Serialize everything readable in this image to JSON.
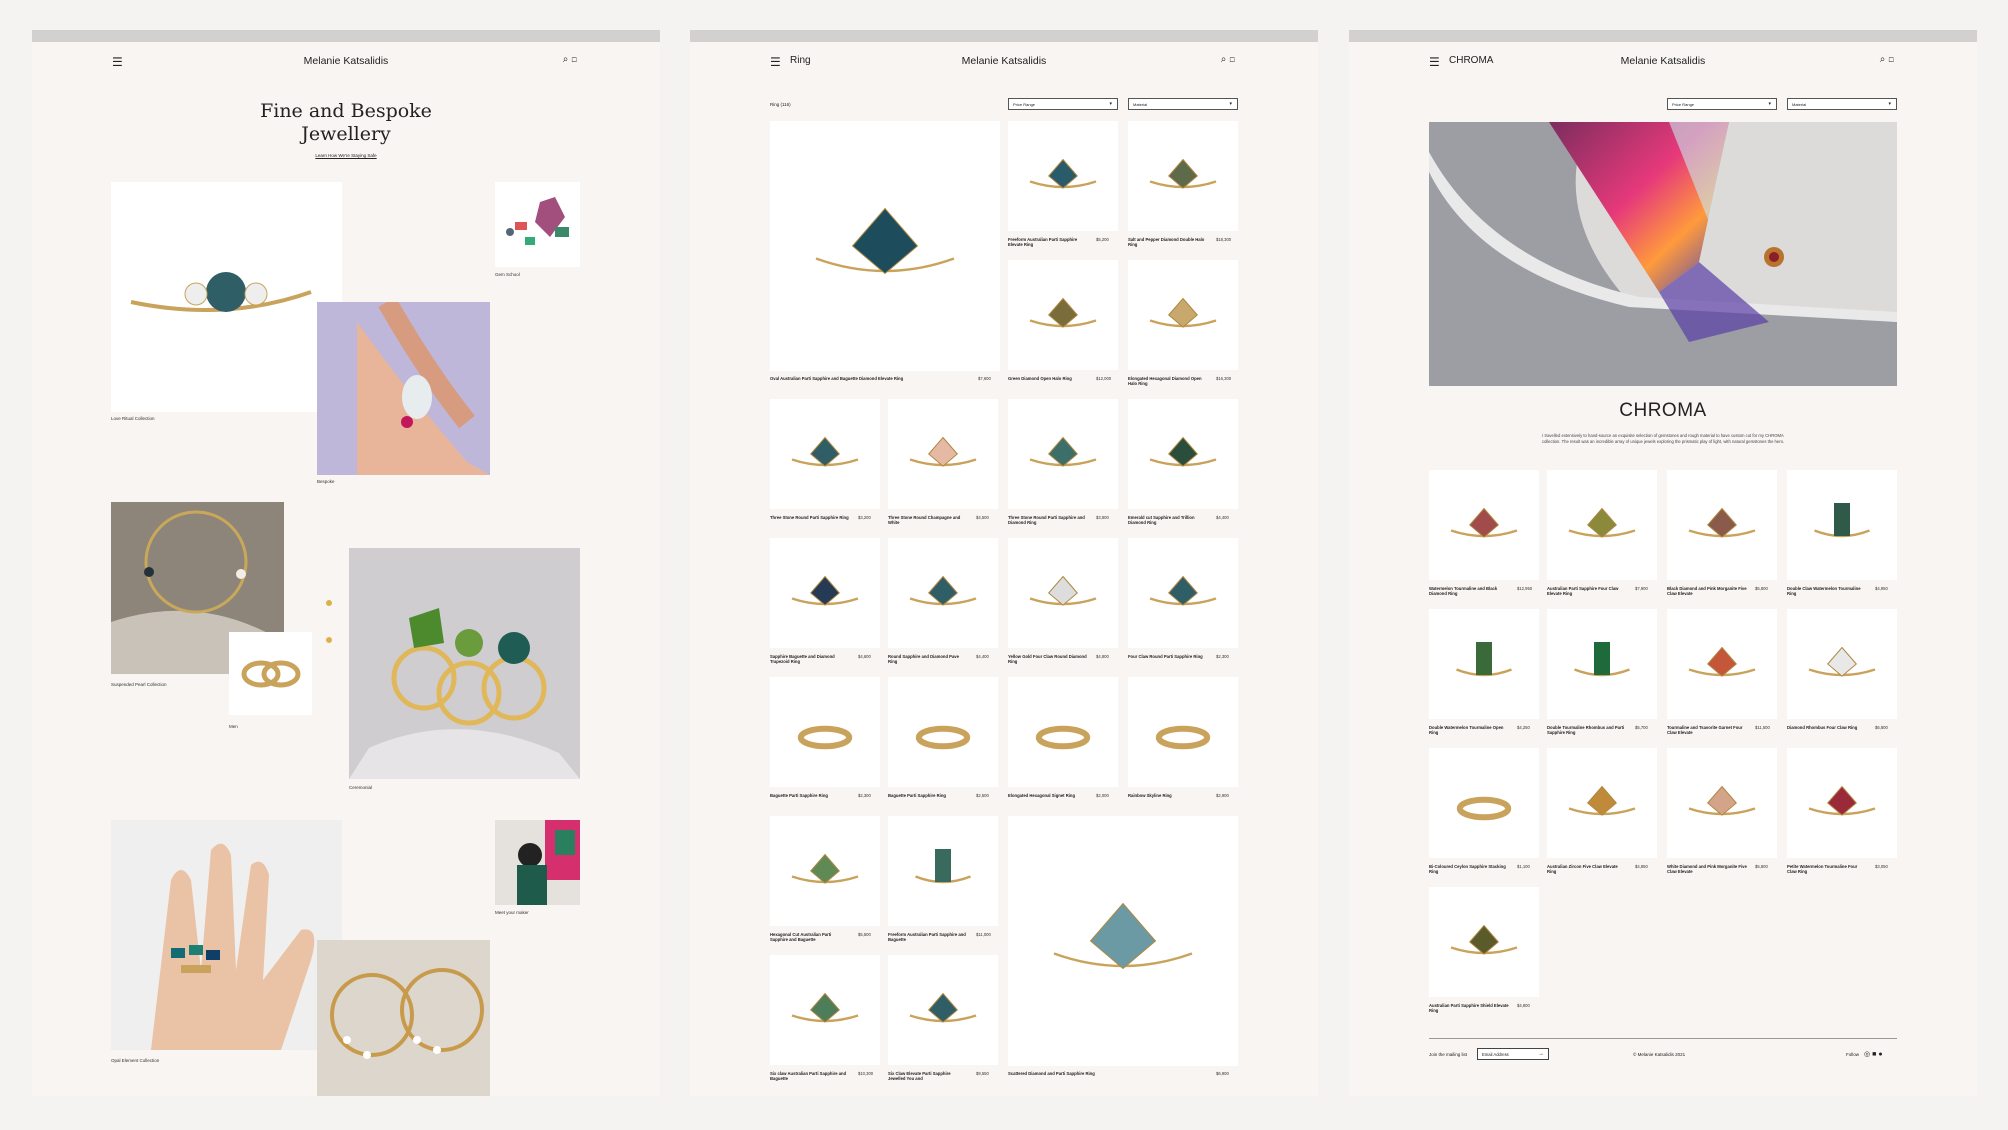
{
  "panel1": {
    "brand": "Melanie Katsalidis",
    "hero_title_line1": "Fine and Bespoke",
    "hero_title_line2": "Jewellery",
    "hero_link": "Learn How We're Staying Safe",
    "captions": {
      "love_ritual": "Love Ritual Collection",
      "gem_school": "Gem School",
      "bespoke": "Bespoke",
      "suspended_pearl": "Suspended Pearl Collection",
      "men": "Men",
      "ceremonial": "Ceremonial",
      "meet_maker": "Meet your maker",
      "opal_element": "Opal Element Collection"
    }
  },
  "panel2": {
    "section": "Ring",
    "brand": "Melanie Katsalidis",
    "breadcrumb": "Ring (116)",
    "filter_price": "Price Range",
    "filter_material": "Material",
    "products": [
      {
        "name": "Oval Australian Parti Sapphire and Baguette Diamond Elevate Ring",
        "price": "$7,600"
      },
      {
        "name": "Freeform Australian Parti Sapphire Elevate Ring",
        "price": "$5,200"
      },
      {
        "name": "Salt and Pepper Diamond Double Halo Ring",
        "price": "$18,300"
      },
      {
        "name": "Green Diamond Open Halo Ring",
        "price": "$12,000"
      },
      {
        "name": "Elongated Hexagonal Diamond Open Halo Ring",
        "price": "$16,300"
      },
      {
        "name": "Three Stone Round Parti Sapphire Ring",
        "price": "$3,200"
      },
      {
        "name": "Three Stone Round Champagne and White",
        "price": "$4,500"
      },
      {
        "name": "Three Stone Round Parti Sapphire and Diamond Ring",
        "price": "$3,800"
      },
      {
        "name": "Emerald cut Sapphire and Trillion Diamond Ring",
        "price": "$4,400"
      },
      {
        "name": "Sapphire Baguette and Diamond Trapezoid Ring",
        "price": "$4,600"
      },
      {
        "name": "Round Sapphire and Diamond Pave Ring",
        "price": "$4,400"
      },
      {
        "name": "Yellow Gold Four Claw Round Diamond Ring",
        "price": "$4,800"
      },
      {
        "name": "Four Claw Round Parti Sapphire Ring",
        "price": "$2,300"
      },
      {
        "name": "Baguette Parti Sapphire Ring",
        "price": "$2,300"
      },
      {
        "name": "Baguette Parti Sapphire Ring",
        "price": "$2,500"
      },
      {
        "name": "Elongated Hexagonal Signet Ring",
        "price": "$2,000"
      },
      {
        "name": "Rainbow Skyline Ring",
        "price": "$2,900"
      },
      {
        "name": "Hexagonal Cut Australian Parti Sapphire and Baguette",
        "price": "$5,500"
      },
      {
        "name": "Freeform Australian Parti Sapphire and Baguette",
        "price": "$11,000"
      },
      {
        "name": "Six claw Australian Parti Sapphire and Baguette",
        "price": "$10,300"
      },
      {
        "name": "Six Claw Elevate Parti Sapphire Jewelled You and",
        "price": "$9,550"
      },
      {
        "name": "Scattered Diamond and Parti Sapphire Ring",
        "price": "$6,900"
      }
    ]
  },
  "panel3": {
    "section": "CHROMA",
    "brand": "Melanie Katsalidis",
    "filter_price": "Price Range",
    "filter_material": "Material",
    "title": "CHROMA",
    "description": "I travelled extensively to hand-source an exquisite selection of gemstones and rough material to have custom cut for my CHROMA collection. The result was an incredible array of unique jewels exploring the prismatic play of light, with natural gemstones the hero.",
    "products": [
      {
        "name": "Watermelon Tourmaline and Black Diamond Ring",
        "price": "$12,950"
      },
      {
        "name": "Australian Parti Sapphire Four Claw Elevate Ring",
        "price": "$7,900"
      },
      {
        "name": "Black Diamond and Pink Morganite Five Claw Elevate",
        "price": "$5,800"
      },
      {
        "name": "Double Claw Watermelon Tourmaline Ring",
        "price": "$4,950"
      },
      {
        "name": "Double Watermelon Tourmaline Open Ring",
        "price": "$4,250"
      },
      {
        "name": "Double Tourmaline Rhombus and Parti Sapphire Ring",
        "price": "$5,700"
      },
      {
        "name": "Tourmaline and Tsavorite Garnet Four Claw Elevate",
        "price": "$11,500"
      },
      {
        "name": "Diamond Rhombus Four Claw Ring",
        "price": "$6,800"
      },
      {
        "name": "Bi-Coloured Ceylon Sapphire Stacking Ring",
        "price": "$1,100"
      },
      {
        "name": "Australian Zircon Five Claw Elevate Ring",
        "price": "$4,850"
      },
      {
        "name": "White Diamond and Pink Morganite Five Claw Elevate",
        "price": "$5,800"
      },
      {
        "name": "Petite Watermelon Tourmaline Four Claw Ring",
        "price": "$3,050"
      },
      {
        "name": "Australian Parti Sapphire Shield Elevate Ring",
        "price": "$4,800"
      }
    ],
    "mailing_label": "Join the mailing list",
    "email_placeholder": "Email Address",
    "copyright": "© Melanie Katsalidis 2021",
    "follow": "Follow"
  },
  "colors": {
    "background": "#f8f5f2",
    "gold": "#d9b24a",
    "text": "#222222"
  }
}
